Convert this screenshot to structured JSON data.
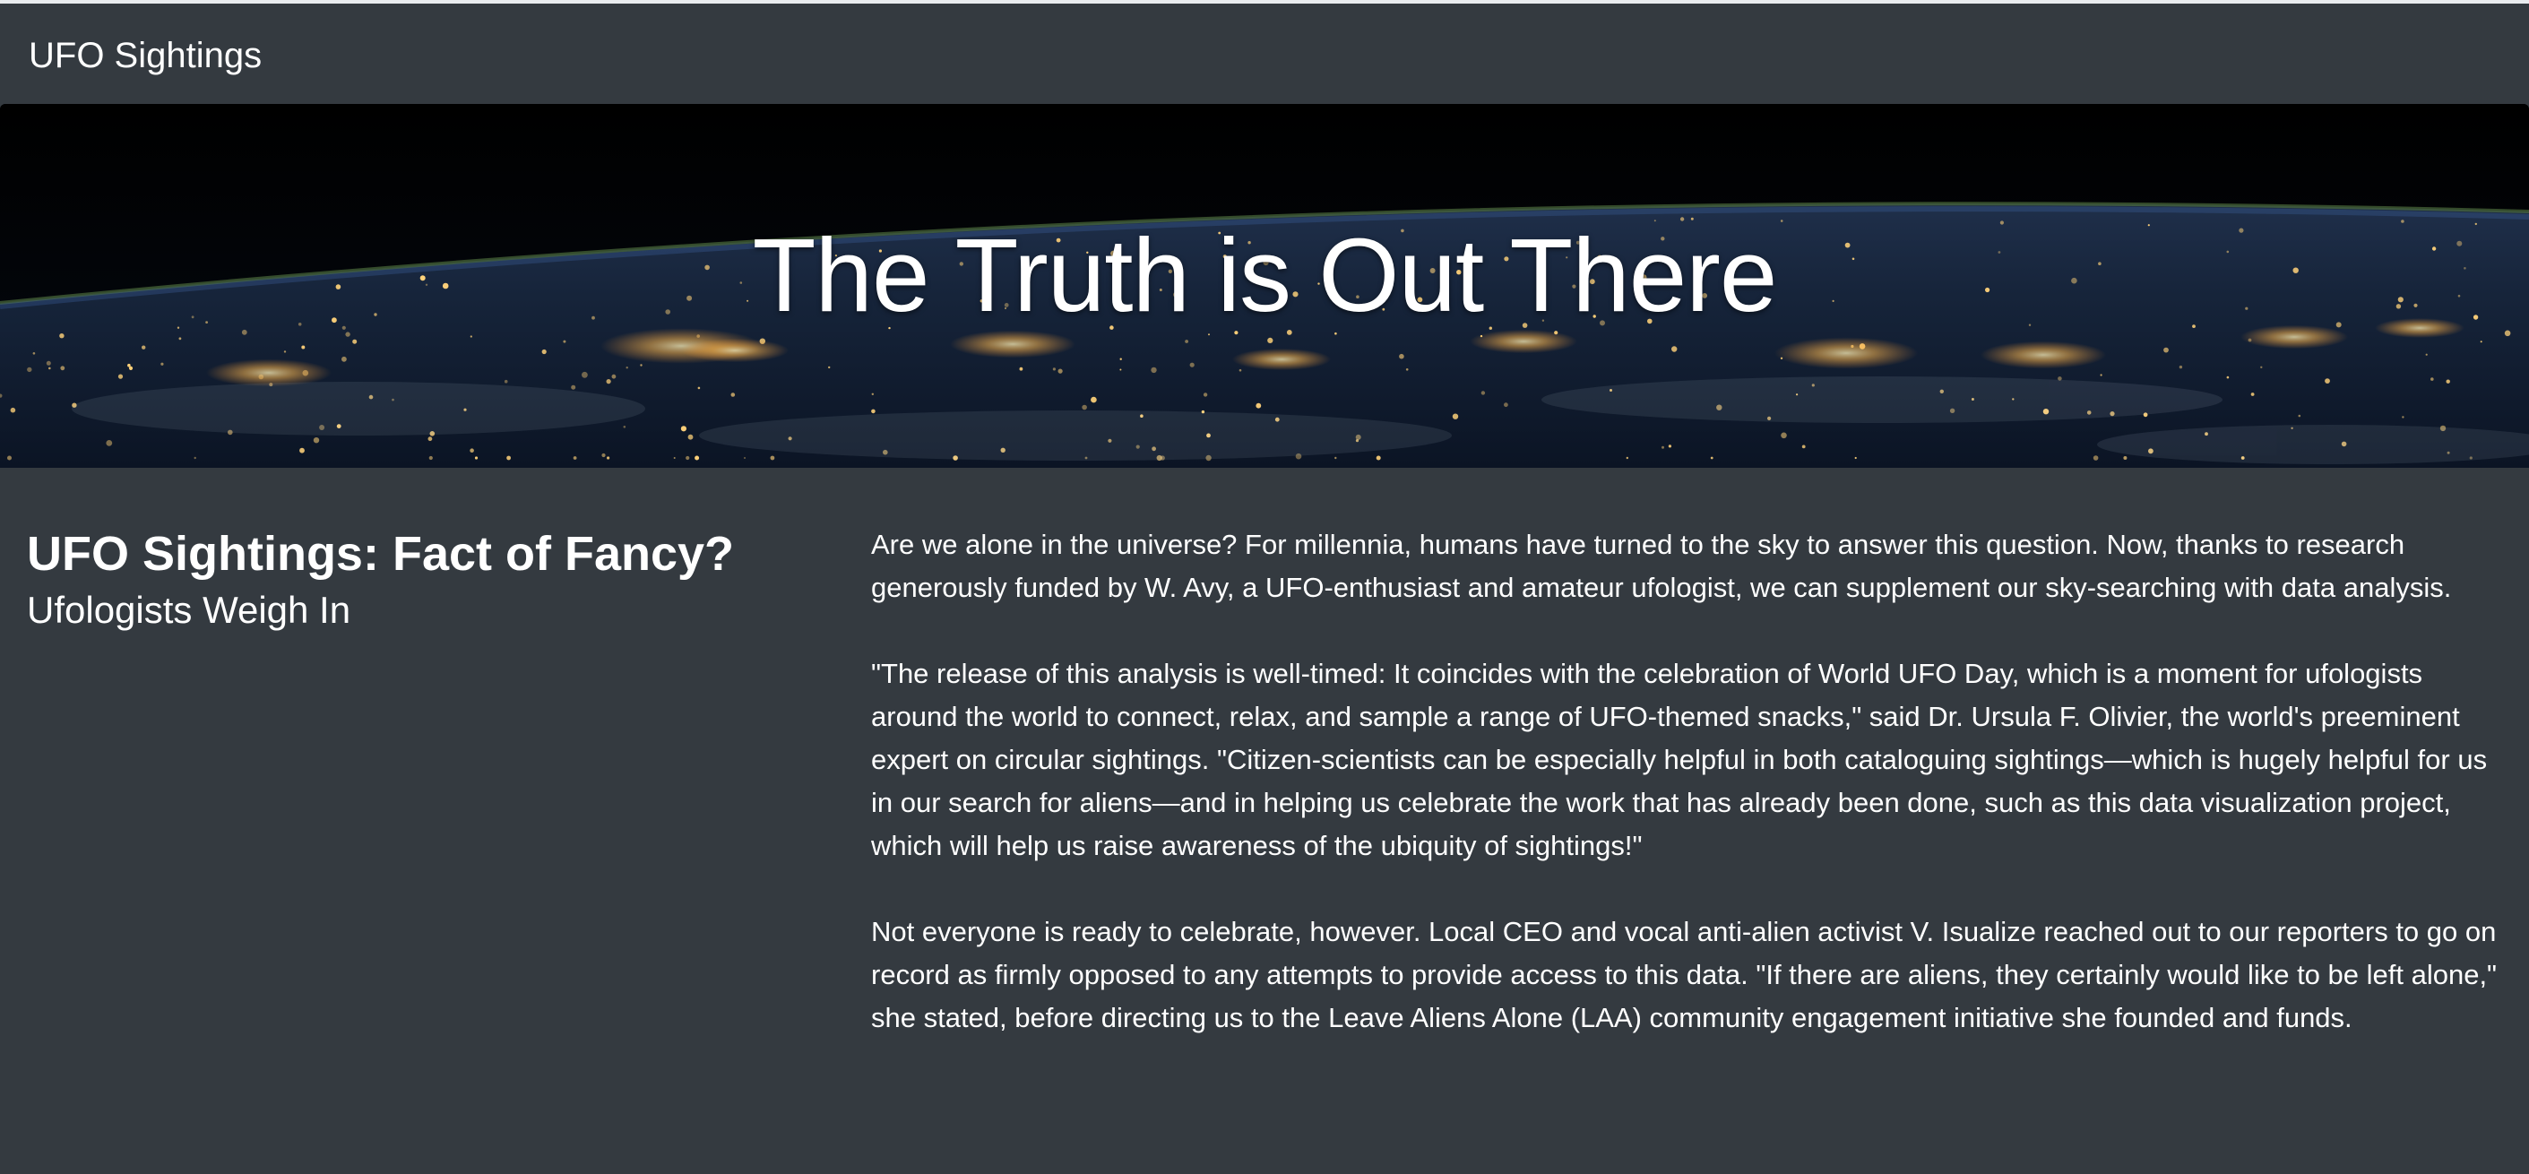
{
  "navbar": {
    "brand": "UFO Sightings"
  },
  "hero": {
    "title": "The Truth is Out There",
    "background_icon": "earth-at-night-image"
  },
  "main": {
    "headline": "UFO Sightings: Fact of Fancy?",
    "subheadline": "Ufologists Weigh In",
    "paragraphs": [
      "Are we alone in the universe? For millennia, humans have turned to the sky to answer this question. Now, thanks to research generously funded by W. Avy, a UFO-enthusiast and amateur ufologist, we can supplement our sky-searching with data analysis.",
      "\"The release of this analysis is well-timed: It coincides with the celebration of World UFO Day, which is a moment for ufologists around the world to connect, relax, and sample a range of UFO-themed snacks,\" said Dr. Ursula F. Olivier, the world's preeminent expert on circular sightings. \"Citizen-scientists can be especially helpful in both cataloguing sightings—which is hugely helpful for us in our search for aliens—and in helping us celebrate the work that has already been done, such as this data visualization project, which will help us raise awareness of the ubiquity of sightings!\"",
      "Not everyone is ready to celebrate, however. Local CEO and vocal anti-alien activist V. Isualize reached out to our reporters to go on record as firmly opposed to any attempts to provide access to this data. \"If there are aliens, they certainly would like to be left alone,\" she stated, before directing us to the Leave Aliens Alone (LAA) community engagement initiative she founded and funds."
    ]
  },
  "colors": {
    "page_background": "#343a40",
    "text": "#ffffff",
    "hero_space": "#02040a",
    "city_lights": "#ffd27a"
  }
}
